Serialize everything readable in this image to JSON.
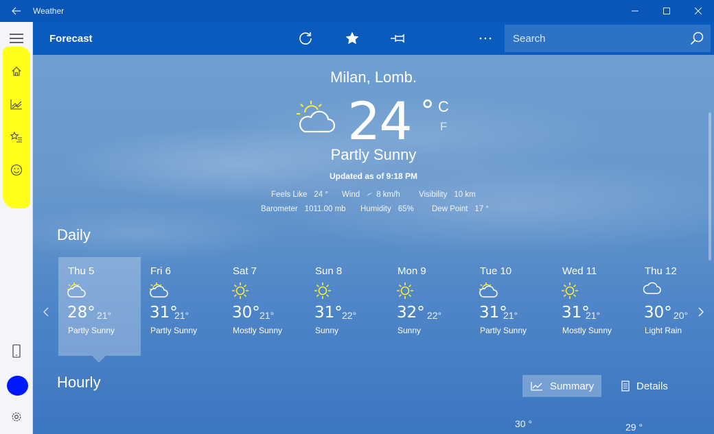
{
  "window": {
    "title": "Weather"
  },
  "appbar": {
    "title": "Forecast",
    "search_placeholder": "Search"
  },
  "current": {
    "city": "Milan, Lomb.",
    "temperature": "24",
    "degree": "°",
    "unit_c": "C",
    "unit_f": "F",
    "condition": "Partly Sunny",
    "updated": "Updated as of 9:18 PM",
    "feels_like_label": "Feels Like",
    "feels_like": "24 °",
    "wind_label": "Wind",
    "wind": "8 km/h",
    "visibility_label": "Visibility",
    "visibility": "10 km",
    "barometer_label": "Barometer",
    "barometer": "1011.00 mb",
    "humidity_label": "Humidity",
    "humidity": "65%",
    "dew_point_label": "Dew Point",
    "dew_point": "17 °"
  },
  "daily": {
    "title": "Daily",
    "days": [
      {
        "name": "Thu 5",
        "hi": "28°",
        "lo": "21°",
        "cond": "Partly Sunny",
        "icon": "partly-sunny"
      },
      {
        "name": "Fri 6",
        "hi": "31°",
        "lo": "21°",
        "cond": "Partly Sunny",
        "icon": "partly-sunny"
      },
      {
        "name": "Sat 7",
        "hi": "30°",
        "lo": "21°",
        "cond": "Mostly Sunny",
        "icon": "sunny"
      },
      {
        "name": "Sun 8",
        "hi": "31°",
        "lo": "22°",
        "cond": "Sunny",
        "icon": "sunny"
      },
      {
        "name": "Mon 9",
        "hi": "32°",
        "lo": "22°",
        "cond": "Sunny",
        "icon": "sunny"
      },
      {
        "name": "Tue 10",
        "hi": "31°",
        "lo": "21°",
        "cond": "Partly Sunny",
        "icon": "partly-sunny"
      },
      {
        "name": "Wed 11",
        "hi": "31°",
        "lo": "21°",
        "cond": "Mostly Sunny",
        "icon": "sunny"
      },
      {
        "name": "Thu 12",
        "hi": "30°",
        "lo": "20°",
        "cond": "Light Rain",
        "icon": "cloud"
      }
    ]
  },
  "hourly": {
    "title": "Hourly",
    "summary_label": "Summary",
    "details_label": "Details",
    "temps": [
      "30 °",
      "29 °"
    ]
  },
  "colors": {
    "highlight": "#ffff1a",
    "blob": "#0018ff",
    "appbar": "#0a5bbd",
    "sun": "#ffee33"
  }
}
